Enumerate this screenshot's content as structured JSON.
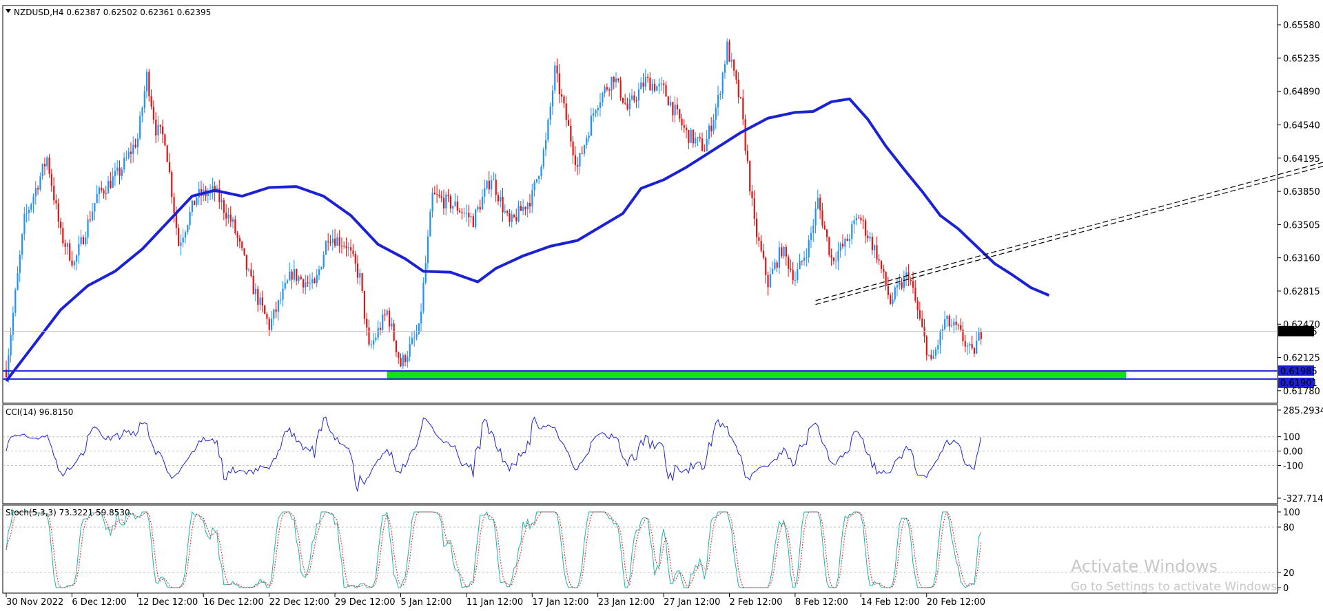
{
  "chart_data": {
    "type": "candlestick",
    "symbol_header": "NZDUSD,H4  0.62387 0.62502 0.62361 0.62395",
    "price_axis": {
      "ylim": [
        0.6165,
        0.6578
      ],
      "ticks": [
        "0.65580",
        "0.65235",
        "0.64890",
        "0.64540",
        "0.64195",
        "0.63850",
        "0.63505",
        "0.63160",
        "0.62815",
        "0.62470",
        "0.62125",
        "0.61780"
      ],
      "tick_values": [
        0.6558,
        0.65235,
        0.6489,
        0.6454,
        0.64195,
        0.6385,
        0.63505,
        0.6316,
        0.62815,
        0.6247,
        0.62125,
        0.6178
      ]
    },
    "time_axis": {
      "labels": [
        "30 Nov 2022",
        "6 Dec 12:00",
        "12 Dec 12:00",
        "16 Dec 12:00",
        "22 Dec 12:00",
        "29 Dec 12:00",
        "5 Jan 12:00",
        "11 Jan 12:00",
        "17 Jan 12:00",
        "23 Jan 12:00",
        "27 Jan 12:00",
        "2 Feb 12:00",
        "8 Feb 12:00",
        "14 Feb 12:00",
        "20 Feb 12:00"
      ],
      "label_bar_index": [
        0,
        29,
        58,
        87,
        116,
        145,
        174,
        203,
        232,
        261,
        290,
        319,
        348,
        377,
        406
      ],
      "total_bars": 430
    },
    "price_path": [
      [
        0,
        0.62
      ],
      [
        8,
        0.6355
      ],
      [
        18,
        0.642
      ],
      [
        24,
        0.634
      ],
      [
        30,
        0.631
      ],
      [
        40,
        0.638
      ],
      [
        50,
        0.6405
      ],
      [
        58,
        0.644
      ],
      [
        62,
        0.6505
      ],
      [
        66,
        0.645
      ],
      [
        70,
        0.644
      ],
      [
        76,
        0.633
      ],
      [
        84,
        0.638
      ],
      [
        92,
        0.6385
      ],
      [
        100,
        0.635
      ],
      [
        108,
        0.629
      ],
      [
        116,
        0.6245
      ],
      [
        126,
        0.63
      ],
      [
        136,
        0.6285
      ],
      [
        142,
        0.634
      ],
      [
        150,
        0.633
      ],
      [
        156,
        0.6295
      ],
      [
        160,
        0.622
      ],
      [
        168,
        0.626
      ],
      [
        174,
        0.6205
      ],
      [
        182,
        0.624
      ],
      [
        188,
        0.638
      ],
      [
        198,
        0.637
      ],
      [
        206,
        0.6355
      ],
      [
        214,
        0.64
      ],
      [
        222,
        0.635
      ],
      [
        232,
        0.638
      ],
      [
        238,
        0.6435
      ],
      [
        242,
        0.651
      ],
      [
        246,
        0.647
      ],
      [
        252,
        0.641
      ],
      [
        260,
        0.6475
      ],
      [
        268,
        0.6505
      ],
      [
        274,
        0.647
      ],
      [
        282,
        0.65
      ],
      [
        290,
        0.649
      ],
      [
        300,
        0.6445
      ],
      [
        308,
        0.643
      ],
      [
        314,
        0.648
      ],
      [
        318,
        0.6535
      ],
      [
        324,
        0.6475
      ],
      [
        330,
        0.635
      ],
      [
        336,
        0.629
      ],
      [
        342,
        0.6325
      ],
      [
        348,
        0.6295
      ],
      [
        354,
        0.633
      ],
      [
        358,
        0.6375
      ],
      [
        364,
        0.6315
      ],
      [
        370,
        0.633
      ],
      [
        376,
        0.636
      ],
      [
        384,
        0.632
      ],
      [
        390,
        0.627
      ],
      [
        398,
        0.63
      ],
      [
        404,
        0.624
      ],
      [
        408,
        0.6205
      ],
      [
        414,
        0.625
      ],
      [
        420,
        0.624
      ],
      [
        426,
        0.6215
      ],
      [
        430,
        0.6239
      ]
    ],
    "current_price": {
      "value": 0.62395,
      "label": "0.62395"
    },
    "moving_average": {
      "color": "#1b22d6",
      "points": [
        [
          0,
          0.6188
        ],
        [
          12,
          0.6225
        ],
        [
          24,
          0.6262
        ],
        [
          36,
          0.6287
        ],
        [
          48,
          0.6302
        ],
        [
          60,
          0.6325
        ],
        [
          72,
          0.6355
        ],
        [
          82,
          0.638
        ],
        [
          92,
          0.6386
        ],
        [
          104,
          0.638
        ],
        [
          116,
          0.6389
        ],
        [
          128,
          0.639
        ],
        [
          140,
          0.638
        ],
        [
          152,
          0.636
        ],
        [
          164,
          0.633
        ],
        [
          176,
          0.6315
        ],
        [
          184,
          0.6302
        ],
        [
          196,
          0.6301
        ],
        [
          208,
          0.6291
        ],
        [
          216,
          0.6305
        ],
        [
          228,
          0.6318
        ],
        [
          240,
          0.6328
        ],
        [
          252,
          0.6334
        ],
        [
          262,
          0.6348
        ],
        [
          272,
          0.6362
        ],
        [
          280,
          0.6388
        ],
        [
          290,
          0.6397
        ],
        [
          300,
          0.641
        ],
        [
          312,
          0.6428
        ],
        [
          324,
          0.6446
        ],
        [
          336,
          0.6461
        ],
        [
          348,
          0.6467
        ],
        [
          356,
          0.6468
        ],
        [
          364,
          0.6478
        ],
        [
          372,
          0.6481
        ],
        [
          380,
          0.646
        ],
        [
          388,
          0.6432
        ],
        [
          396,
          0.6408
        ],
        [
          404,
          0.6385
        ],
        [
          412,
          0.636
        ],
        [
          420,
          0.6346
        ],
        [
          428,
          0.6328
        ],
        [
          436,
          0.631
        ],
        [
          444,
          0.6298
        ],
        [
          452,
          0.6285
        ],
        [
          460,
          0.6277
        ]
      ]
    },
    "support_zone": {
      "upper": 0.61985,
      "lower": 0.61901,
      "upper_label": "0.61985",
      "lower_label": "0.61901",
      "line_color": "#1b22d6",
      "fill_color": "#16e01a",
      "fill_from_bar": 168,
      "fill_to_bar": 494
    },
    "trend_channel": {
      "color": "#000000",
      "from": [
        357,
        0.62675
      ],
      "to": [
        608,
        0.64285
      ],
      "gap": 0.0004
    },
    "indicators": [
      {
        "name": "CCI(14)",
        "label": "CCI(14) 96.8150",
        "value": 96.815,
        "ylim": [
          -327.7142,
          285.2934
        ],
        "ticks": [
          "285.2934",
          "100",
          "0.00",
          "-100",
          "-327.7142"
        ],
        "levels": [
          100,
          0,
          -100
        ],
        "color": "#1b22d6"
      },
      {
        "name": "Stoch(5,3,3)",
        "label": "Stoch(5,3,3) 73.3221 59.8530",
        "main": 73.3221,
        "signal": 59.853,
        "ylim": [
          0,
          100
        ],
        "ticks": [
          "100",
          "80",
          "20",
          "0"
        ],
        "levels": [
          80,
          20
        ],
        "main_color": "#20b2aa",
        "signal_color": "#e02020"
      }
    ]
  },
  "watermark": {
    "line1": "Activate Windows",
    "line2": "Go to Settings to activate Windows."
  },
  "colors": {
    "bull": "#1e90ff",
    "bear": "#e81010",
    "grid": "#c0c0c0",
    "frame": "#000000"
  }
}
